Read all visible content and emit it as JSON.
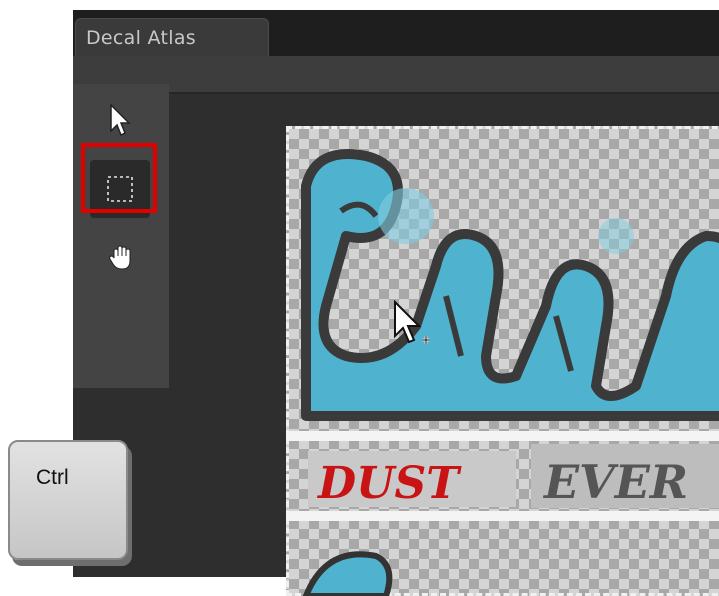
{
  "window": {
    "tab_label": "Decal Atlas"
  },
  "tools": [
    {
      "name": "select-arrow-icon",
      "selected": false
    },
    {
      "name": "rectangle-select-icon",
      "selected": true
    },
    {
      "name": "hand-pan-icon",
      "selected": false
    }
  ],
  "atlas": {
    "decals": [
      "graffiti-blue",
      "DUST",
      "EVER"
    ]
  },
  "keyboard": {
    "key_label": "Ctrl"
  },
  "colors": {
    "highlight": "#e00000",
    "graffiti_blue": "#4fb3cf",
    "dust_red": "#c81414"
  }
}
